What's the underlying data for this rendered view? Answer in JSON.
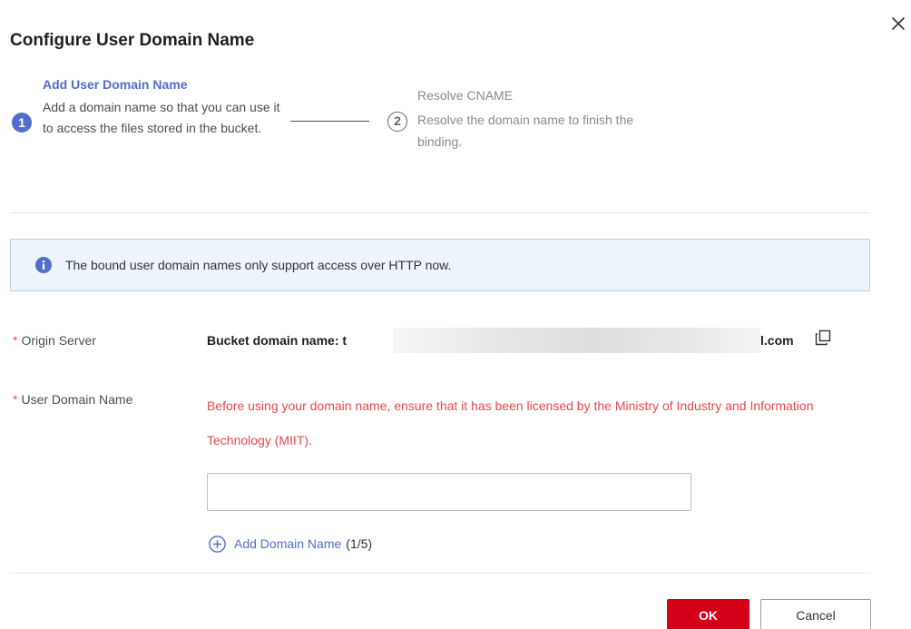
{
  "dialog": {
    "title": "Configure User Domain Name",
    "close_icon": "close-icon"
  },
  "steps": [
    {
      "number": "1",
      "title": "Add User Domain Name",
      "description": "Add a domain name so that you can use it to access the files stored in the bucket.",
      "state": "active"
    },
    {
      "number": "2",
      "title": "Resolve CNAME",
      "description": "Resolve the domain name to finish the binding.",
      "state": "inactive"
    }
  ],
  "info_banner": {
    "icon": "info-icon",
    "text": "The bound user domain names only support access over HTTP now."
  },
  "form": {
    "origin_server": {
      "label": "Origin Server",
      "value_prefix": "Bucket domain name:  t",
      "value_suffix": "l.com",
      "copy_icon": "copy-icon"
    },
    "user_domain": {
      "label": "User Domain Name",
      "warning": "Before using your domain name, ensure that it has been licensed by the Ministry of Industry and Information Technology (MIIT).",
      "input_value": "",
      "add_label": "Add Domain Name",
      "add_count": "(1/5)"
    },
    "required_mark": "*"
  },
  "buttons": {
    "ok": "OK",
    "cancel": "Cancel"
  },
  "colors": {
    "accent": "#526ecc",
    "danger": "#d4001a",
    "warning_text": "#e5484d",
    "info_bg": "#edf4fc"
  }
}
